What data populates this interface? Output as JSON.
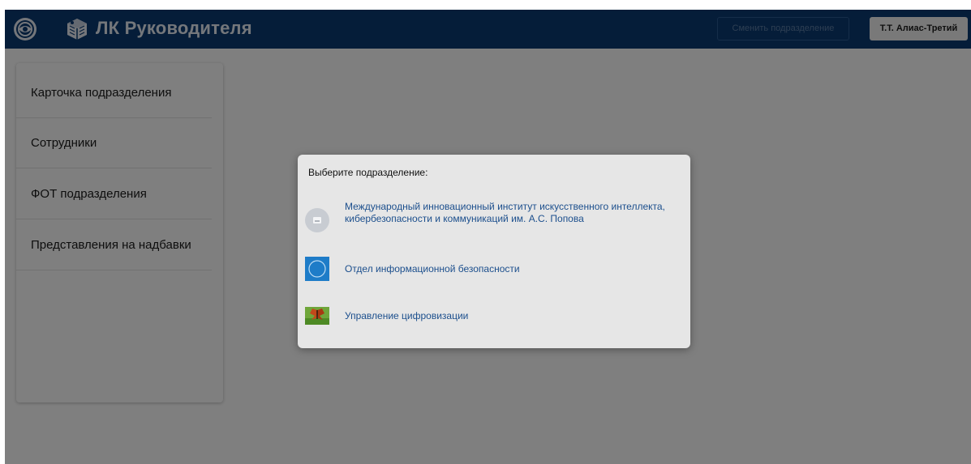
{
  "header": {
    "title": "ЛК Руководителя",
    "change_unit_button": "Сменить подразделение",
    "user_button": "Т.Т. Алиас-Третий"
  },
  "sidebar": {
    "items": [
      {
        "label": "Карточка подразделения"
      },
      {
        "label": "Сотрудники"
      },
      {
        "label": "ФОТ подразделения"
      },
      {
        "label": "Представления на надбавки"
      }
    ]
  },
  "dialog": {
    "title": "Выберите подразделение:",
    "options": [
      {
        "label": "Международный инновационный институт искусственного интеллекта, кибербезопасности и коммуникаций им. А.С. Попова",
        "icon": "placeholder-image-icon"
      },
      {
        "label": "Отдел информационной безопасности",
        "icon": "blue-circle-icon"
      },
      {
        "label": "Управление цифровизации",
        "icon": "butterfly-photo-icon"
      }
    ]
  },
  "colors": {
    "header_bg": "#0a3a72",
    "link": "#1c4f8d",
    "overlay": "rgba(0,0,0,0.5)"
  }
}
